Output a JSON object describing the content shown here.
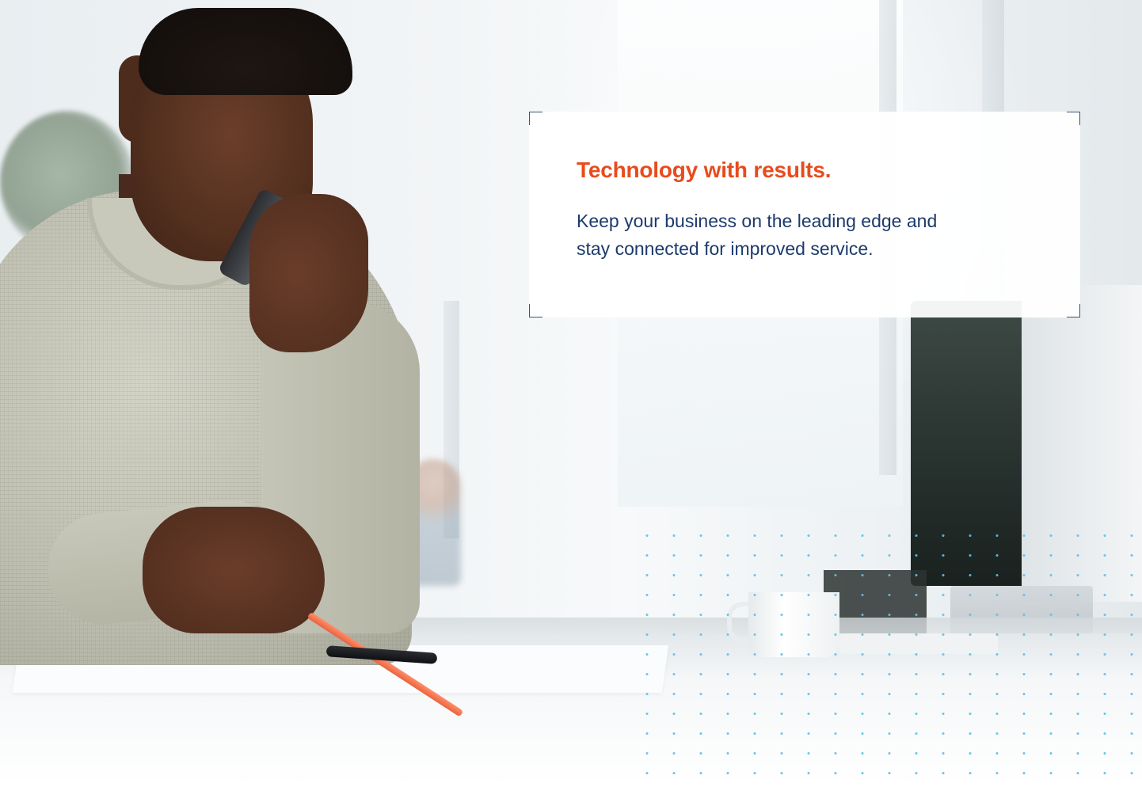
{
  "card": {
    "title": "Technology with results.",
    "body_line_1": "Keep your business on the leading edge and",
    "body_line_2": "stay connected for improved service."
  },
  "colors": {
    "title_accent": "#e84b1d",
    "body_text": "#1c3a6b",
    "corner_marks": "#3c5478",
    "dot_pattern": "#5fc1e4",
    "card_background": "#ffffff"
  },
  "photo": {
    "subject": "man in knit sweater on phone pointing pencil at papers on desk",
    "elements": [
      "phone-icon",
      "pencil",
      "pen",
      "coffee-cup",
      "monitor",
      "dot-grid-pattern"
    ]
  }
}
